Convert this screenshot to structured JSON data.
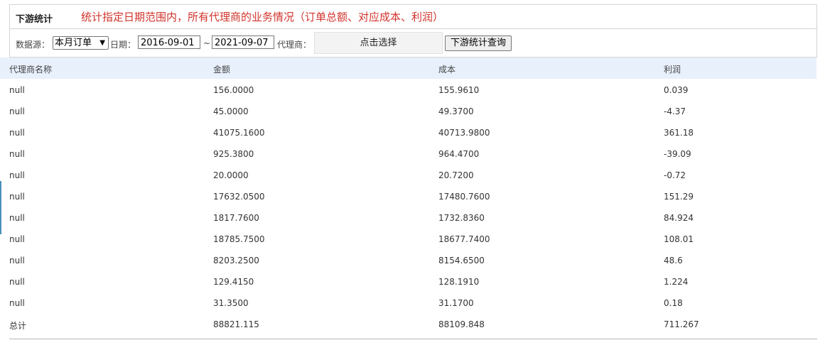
{
  "header": {
    "title": "下游统计",
    "description": "统计指定日期范围内，所有代理商的业务情况（订单总额、对应成本、利润）"
  },
  "toolbar": {
    "datasource_label": "数据源：",
    "datasource_value": "本月订单",
    "date_label": "日期：",
    "date_from": "2016-09-01",
    "date_sep": "~",
    "date_to": "2021-09-07",
    "agent_label": "代理商：",
    "agent_picker": "点击选择",
    "query_button": "下游统计查询"
  },
  "table": {
    "columns": [
      "代理商名称",
      "金额",
      "成本",
      "利润"
    ],
    "rows": [
      [
        "null",
        "156.0000",
        "155.9610",
        "0.039"
      ],
      [
        "null",
        "45.0000",
        "49.3700",
        "-4.37"
      ],
      [
        "null",
        "41075.1600",
        "40713.9800",
        "361.18"
      ],
      [
        "null",
        "925.3800",
        "964.4700",
        "-39.09"
      ],
      [
        "null",
        "20.0000",
        "20.7200",
        "-0.72"
      ],
      [
        "null",
        "17632.0500",
        "17480.7600",
        "151.29"
      ],
      [
        "null",
        "1817.7600",
        "1732.8360",
        "84.924"
      ],
      [
        "null",
        "18785.7500",
        "18677.7400",
        "108.01"
      ],
      [
        "null",
        "8203.2500",
        "8154.6500",
        "48.6"
      ],
      [
        "null",
        "129.4150",
        "128.1910",
        "1.224"
      ],
      [
        "null",
        "31.3500",
        "31.1700",
        "0.18"
      ],
      [
        "总计",
        "88821.115",
        "88109.848",
        "711.267"
      ]
    ]
  },
  "colors": {
    "description_red": "#d0342c",
    "header_bg": "#e8f0fc"
  }
}
